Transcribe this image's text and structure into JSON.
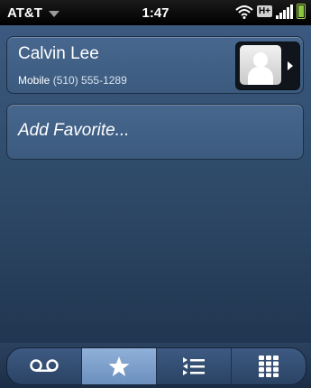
{
  "status": {
    "carrier": "AT&T",
    "time": "1:47",
    "network": "H+"
  },
  "favorites": [
    {
      "name": "Calvin Lee",
      "phone_type": "Mobile",
      "phone_number": "(510) 555-1289"
    }
  ],
  "add_favorite_label": "Add Favorite...",
  "toolbar": {
    "tabs": [
      {
        "icon": "voicemail-icon",
        "glyph": "ᴏᴏ",
        "active": false
      },
      {
        "icon": "star-icon",
        "glyph": "★",
        "active": true
      },
      {
        "icon": "call-log-icon",
        "glyph": "☰",
        "active": false
      },
      {
        "icon": "dialpad-icon",
        "glyph": "▦",
        "active": false
      }
    ]
  },
  "colors": {
    "accent": "#6b8fbe",
    "battery": "#8cc63f"
  }
}
